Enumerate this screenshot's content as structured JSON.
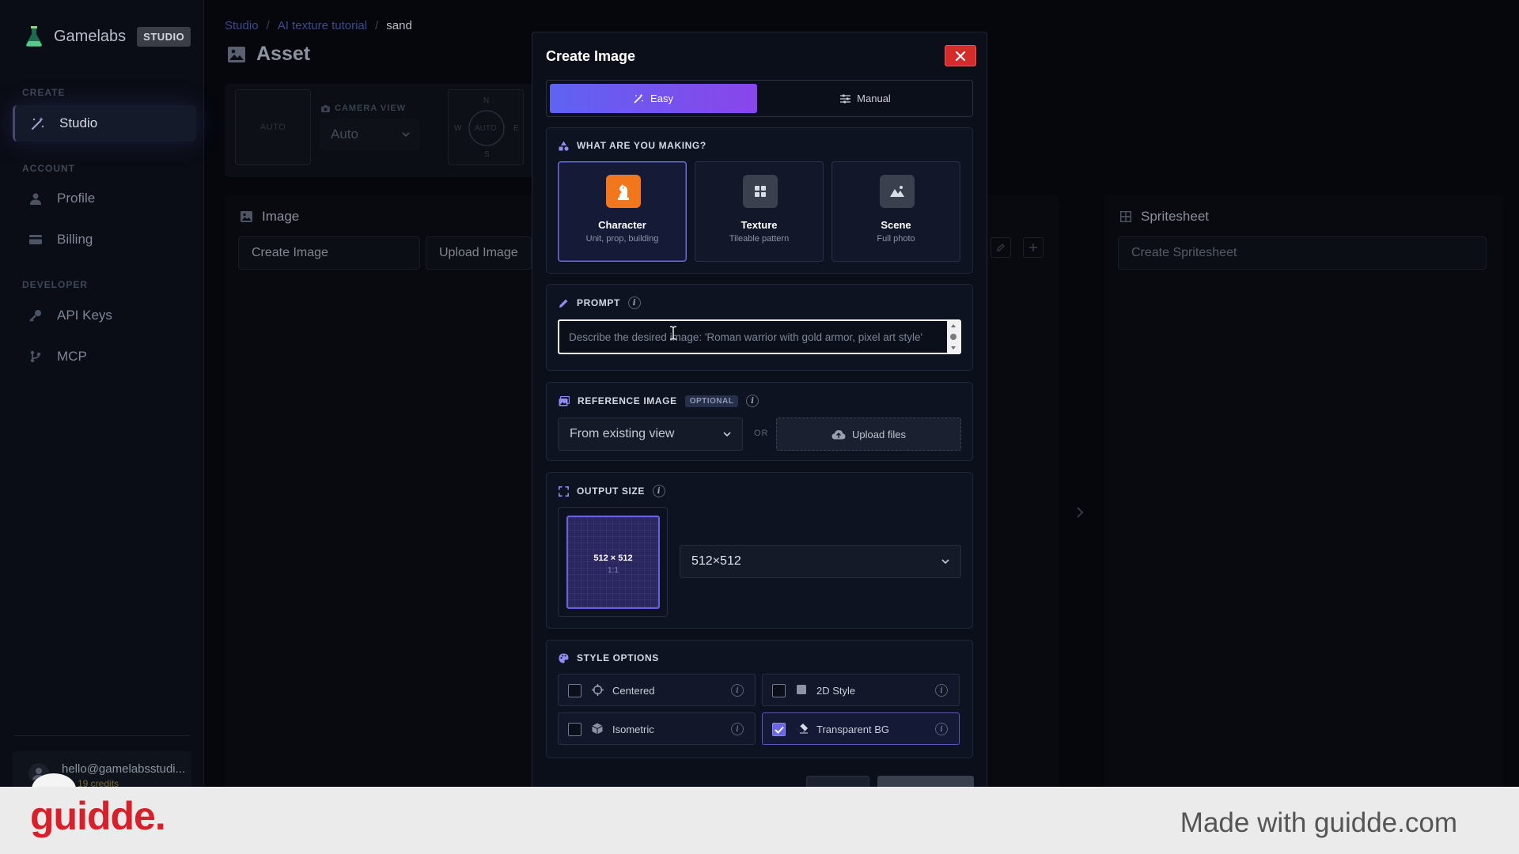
{
  "sidebar": {
    "brand": "Gamelabs",
    "badge": "STUDIO",
    "sections": {
      "create": "CREATE",
      "account": "ACCOUNT",
      "developer": "DEVELOPER"
    },
    "items": [
      {
        "label": "Studio",
        "icon": "wand-icon",
        "active": true
      },
      {
        "label": "Profile",
        "icon": "user-icon"
      },
      {
        "label": "Billing",
        "icon": "card-icon"
      },
      {
        "label": "API Keys",
        "icon": "key-icon"
      },
      {
        "label": "MCP",
        "icon": "branch-icon"
      }
    ],
    "user": {
      "email": "hello@gamelabsstudi...",
      "credits": "19 credits"
    }
  },
  "breadcrumb": {
    "items": [
      "Studio",
      "AI texture tutorial"
    ],
    "current": "sand",
    "separator": "/"
  },
  "page_title": "Asset",
  "toolbar": {
    "auto_box": "AUTO",
    "camera_label": "CAMERA VIEW",
    "camera_value": "Auto",
    "compass": {
      "n": "N",
      "s": "S",
      "e": "E",
      "w": "W",
      "center": "AUTO"
    }
  },
  "image_panel": {
    "title": "Image",
    "tab_create": "Create Image",
    "tab_upload": "Upload Image"
  },
  "spritesheet_panel": {
    "title": "Spritesheet",
    "create_label": "Create Spritesheet"
  },
  "modal": {
    "title": "Create Image",
    "modes": {
      "easy": "Easy",
      "manual": "Manual",
      "active": "easy"
    },
    "making": {
      "heading": "WHAT ARE YOU MAKING?",
      "options": [
        {
          "label": "Character",
          "sub": "Unit, prop, building",
          "selected": true
        },
        {
          "label": "Texture",
          "sub": "Tileable pattern",
          "selected": false
        },
        {
          "label": "Scene",
          "sub": "Full photo",
          "selected": false
        }
      ]
    },
    "prompt": {
      "heading": "PROMPT",
      "placeholder": "Describe the desired image: 'Roman warrior with gold armor, pixel art style'",
      "value": ""
    },
    "reference": {
      "heading": "REFERENCE IMAGE",
      "badge": "OPTIONAL",
      "select_value": "From existing view",
      "or": "OR",
      "upload_label": "Upload files"
    },
    "output_size": {
      "heading": "OUTPUT SIZE",
      "preview_size": "512 × 512",
      "preview_ratio": "1:1",
      "select_value": "512×512"
    },
    "style_options": {
      "heading": "STYLE OPTIONS",
      "options": [
        {
          "label": "Centered",
          "checked": false,
          "icon": "crosshair-icon"
        },
        {
          "label": "2D Style",
          "checked": false,
          "icon": "square-icon"
        },
        {
          "label": "Isometric",
          "checked": false,
          "icon": "cube-icon"
        },
        {
          "label": "Transparent BG",
          "checked": true,
          "icon": "eraser-icon"
        }
      ]
    }
  },
  "watermark": {
    "logo": "guidde.",
    "credit": "Made with guidde.com"
  },
  "colors": {
    "accent": "#6a66e6",
    "character_orange": "#f2761c",
    "close_red": "#d62b2b",
    "guidde_red": "#d81f2a"
  }
}
